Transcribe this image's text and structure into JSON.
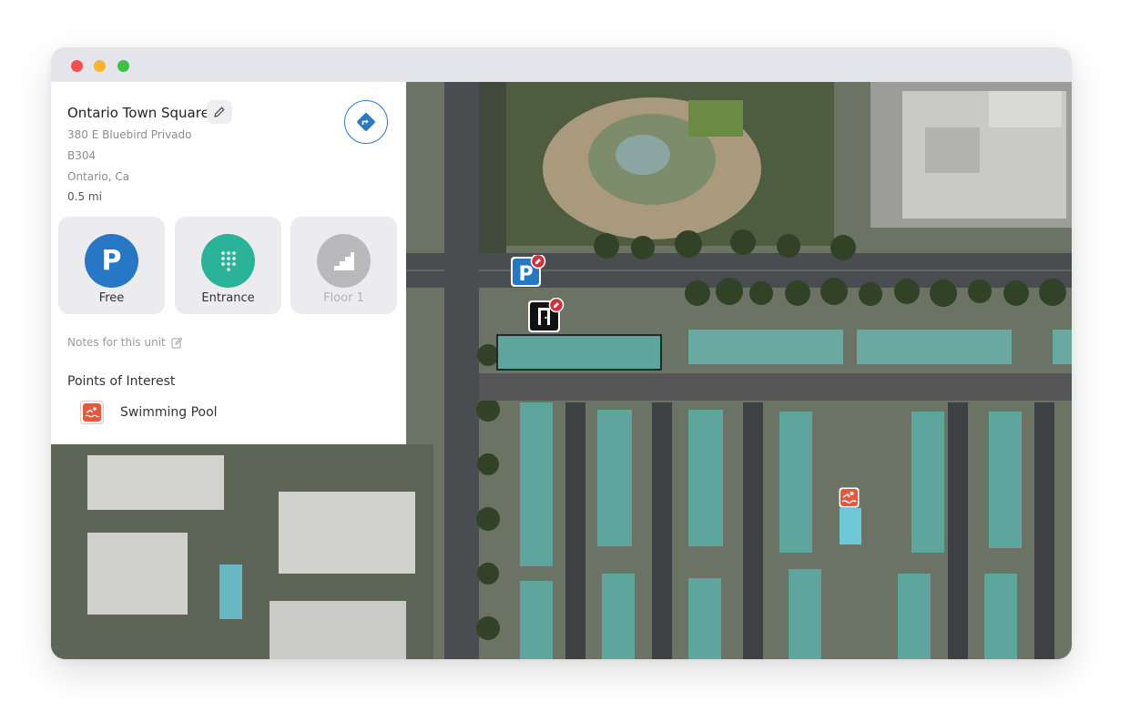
{
  "window": {
    "controls": [
      "close",
      "minimize",
      "zoom"
    ]
  },
  "place": {
    "title": "Ontario Town Square",
    "address_line1": "380 E Bluebird Privado",
    "address_line2": "B304",
    "address_line3": "Ontario, Ca",
    "distance": "0.5 mi"
  },
  "tiles": [
    {
      "label": "Free",
      "icon": "parking-icon",
      "glyph": "P",
      "color": "#2677c6",
      "state": "active"
    },
    {
      "label": "Entrance",
      "icon": "keypad-icon",
      "color": "#2bb39a",
      "state": "active"
    },
    {
      "label": "Floor 1",
      "icon": "stairs-icon",
      "color": "#b9b9bc",
      "state": "disabled"
    }
  ],
  "notes": {
    "label": "Notes for this unit"
  },
  "poi": {
    "heading": "Points of Interest",
    "items": [
      {
        "label": "Swimming Pool",
        "icon": "swimming-pool-icon",
        "color": "#e8573a"
      }
    ]
  },
  "map": {
    "markers": [
      {
        "type": "parking",
        "glyph": "P",
        "icon": "parking-marker-icon"
      },
      {
        "type": "entrance",
        "icon": "door-marker-icon"
      },
      {
        "type": "pool",
        "icon": "swimming-pool-marker-icon"
      }
    ]
  },
  "colors": {
    "accent": "#2677c6",
    "entrance": "#2bb39a",
    "edit_badge": "#d0313b",
    "poi": "#e8573a"
  }
}
